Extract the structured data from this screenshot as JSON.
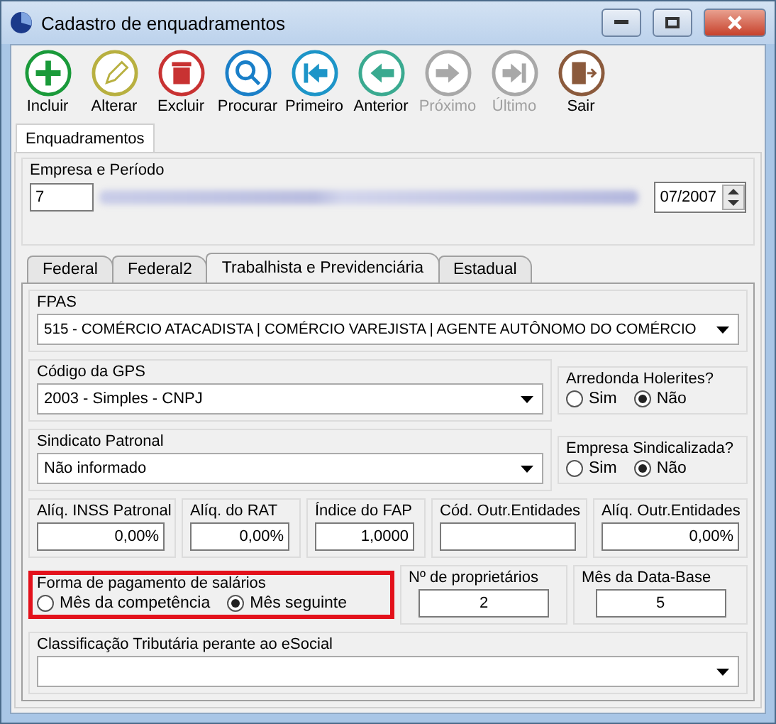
{
  "window": {
    "title": "Cadastro de enquadramentos"
  },
  "toolbar": [
    {
      "kind": "add",
      "label": "Incluir",
      "disabled": false
    },
    {
      "kind": "edit",
      "label": "Alterar",
      "disabled": false
    },
    {
      "kind": "delete",
      "label": "Excluir",
      "disabled": false
    },
    {
      "kind": "search",
      "label": "Procurar",
      "disabled": false
    },
    {
      "kind": "first",
      "label": "Primeiro",
      "disabled": false
    },
    {
      "kind": "previous",
      "label": "Anterior",
      "disabled": false
    },
    {
      "kind": "next",
      "label": "Próximo",
      "disabled": true
    },
    {
      "kind": "last",
      "label": "Último",
      "disabled": true
    },
    {
      "kind": "exit",
      "label": "Sair",
      "disabled": false
    }
  ],
  "outer_tabs": [
    {
      "label": "Enquadramentos",
      "selected": true
    }
  ],
  "company": {
    "legend": "Empresa e Período",
    "code": "7",
    "period": "07/2007"
  },
  "inner_tabs": [
    {
      "label": "Federal",
      "selected": false
    },
    {
      "label": "Federal2",
      "selected": false
    },
    {
      "label": "Trabalhista e Previdenciária",
      "selected": true
    },
    {
      "label": "Estadual",
      "selected": false
    }
  ],
  "fpas": {
    "legend": "FPAS",
    "value": "515 - COMÉRCIO ATACADISTA | COMÉRCIO VAREJISTA | AGENTE AUTÔNOMO DO COMÉRCIO"
  },
  "gps": {
    "legend": "Código da GPS",
    "value": "2003 - Simples - CNPJ"
  },
  "rounding": {
    "legend": "Arredonda Holerites?",
    "options": [
      {
        "label": "Sim",
        "selected": false
      },
      {
        "label": "Não",
        "selected": true
      }
    ]
  },
  "union": {
    "legend": "Sindicato Patronal",
    "value": "Não informado"
  },
  "unionized": {
    "legend": "Empresa Sindicalizada?",
    "options": [
      {
        "label": "Sim",
        "selected": false
      },
      {
        "label": "Não",
        "selected": true
      }
    ]
  },
  "rates": [
    {
      "label": "Alíq. INSS Patronal",
      "value": "0,00%"
    },
    {
      "label": "Alíq. do RAT",
      "value": "0,00%"
    },
    {
      "label": "Índice do FAP",
      "value": "1,0000"
    },
    {
      "label": "Cód. Outr.Entidades"
    },
    {
      "label": "Alíq. Outr.Entidades",
      "value": "0,00%"
    }
  ],
  "payment": {
    "legend": "Forma de pagamento de salários",
    "highlighted": true,
    "options": [
      {
        "label": "Mês da competência",
        "selected": false
      },
      {
        "label": "Mês seguinte",
        "selected": true
      }
    ]
  },
  "owners": {
    "label": "Nº de proprietários",
    "value": "2"
  },
  "base_month": {
    "label": "Mês da Data-Base",
    "value": "5"
  },
  "esocial": {
    "legend": "Classificação Tributária perante ao eSocial"
  }
}
